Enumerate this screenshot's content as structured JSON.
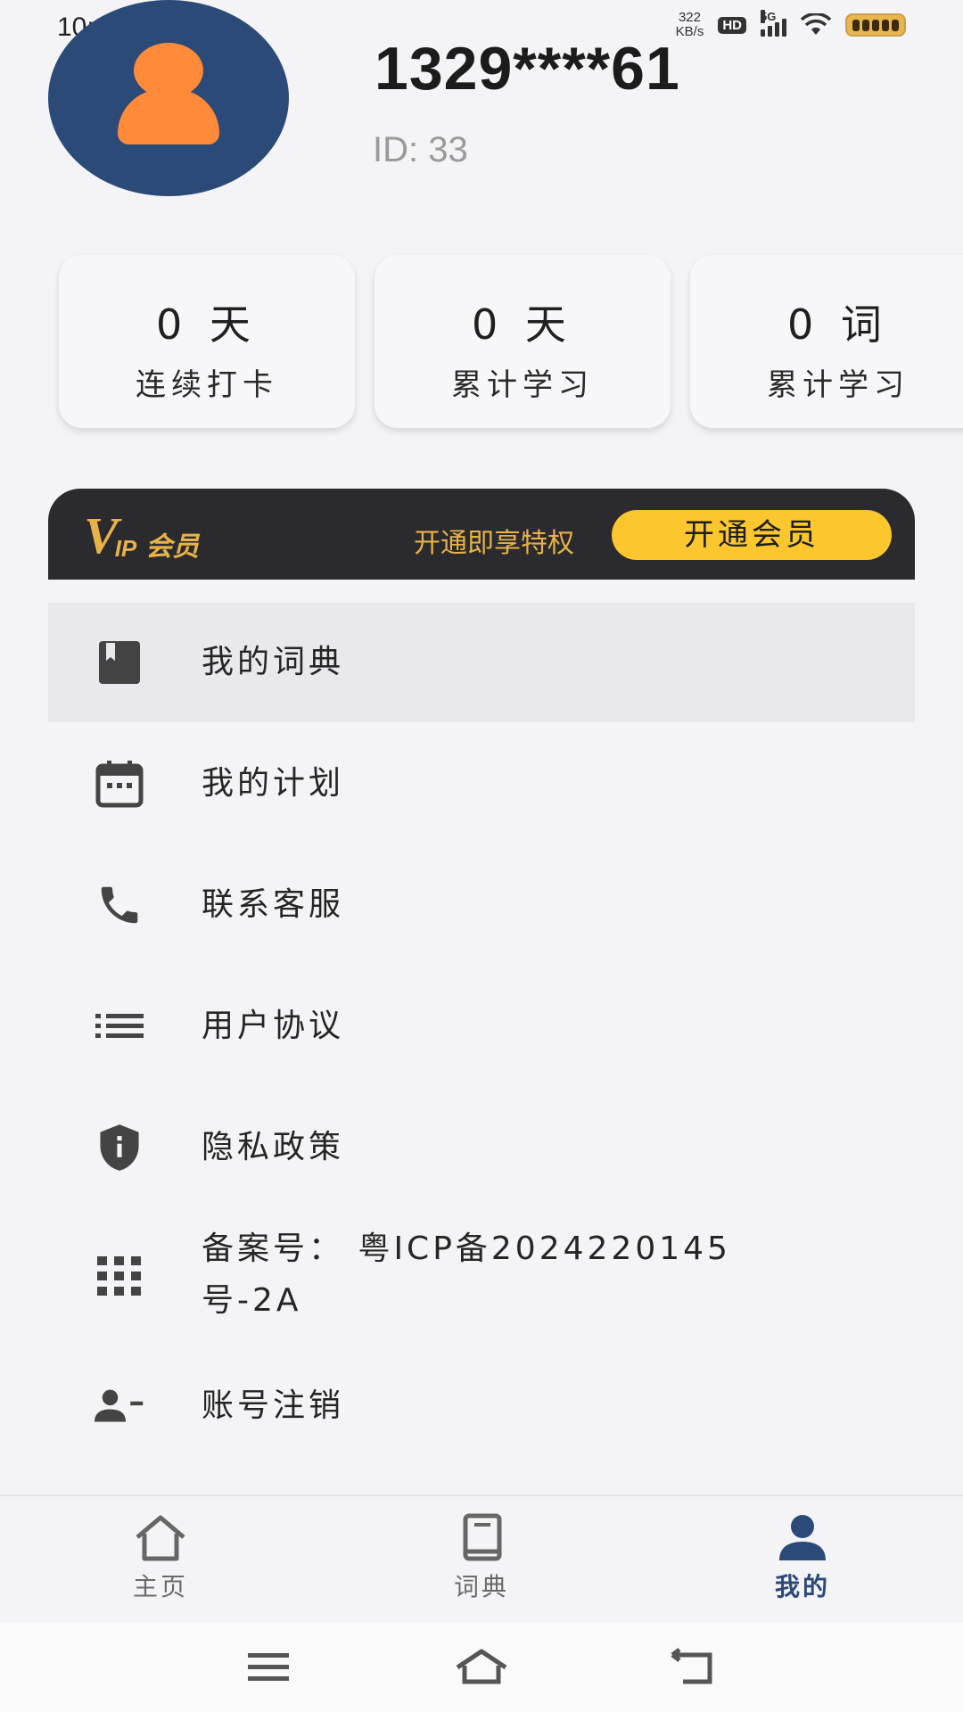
{
  "status_bar": {
    "time": "10:10",
    "net_speed_value": "322",
    "net_speed_unit": "KB/s",
    "hd": "HD",
    "network": "5G",
    "battery_icon": "battery-full-icon",
    "wifi_icon": "wifi-icon",
    "signal_icon": "signal-icon"
  },
  "profile": {
    "avatar_icon": "person-avatar-icon",
    "phone": "1329****61",
    "user_id": "ID: 33"
  },
  "stats": [
    {
      "value": "0 天",
      "label": "连续打卡"
    },
    {
      "value": "0 天",
      "label": "累计学习"
    },
    {
      "value": "0 词",
      "label": "累计学习"
    }
  ],
  "vip": {
    "logo_v": "V",
    "logo_ip": "IP",
    "logo_member": "会员",
    "privilege_text": "开通即享特权",
    "button_label": "开通会员",
    "accent_color": "#e7b247",
    "button_color": "#fcc62f"
  },
  "menu": [
    {
      "icon": "book-bookmark-icon",
      "label": "我的词典"
    },
    {
      "icon": "calendar-icon",
      "label": "我的计划"
    },
    {
      "icon": "phone-icon",
      "label": "联系客服"
    },
    {
      "icon": "list-icon",
      "label": "用户协议"
    },
    {
      "icon": "shield-info-icon",
      "label": "隐私政策"
    },
    {
      "icon": "grid-icon",
      "label_line1": "备案号： 粤ICP备2024220145",
      "label_line2": "号-2A"
    },
    {
      "icon": "person-remove-icon",
      "label": "账号注销"
    }
  ],
  "bottom_nav": [
    {
      "icon": "home-icon",
      "label": "主页"
    },
    {
      "icon": "book-icon",
      "label": "词典"
    },
    {
      "icon": "person-icon",
      "label": "我的"
    }
  ],
  "active_tab_color": "#2c4a77",
  "system_nav": {
    "menu_icon": "menu-icon",
    "home_icon": "home-outline-icon",
    "back_icon": "back-icon"
  }
}
